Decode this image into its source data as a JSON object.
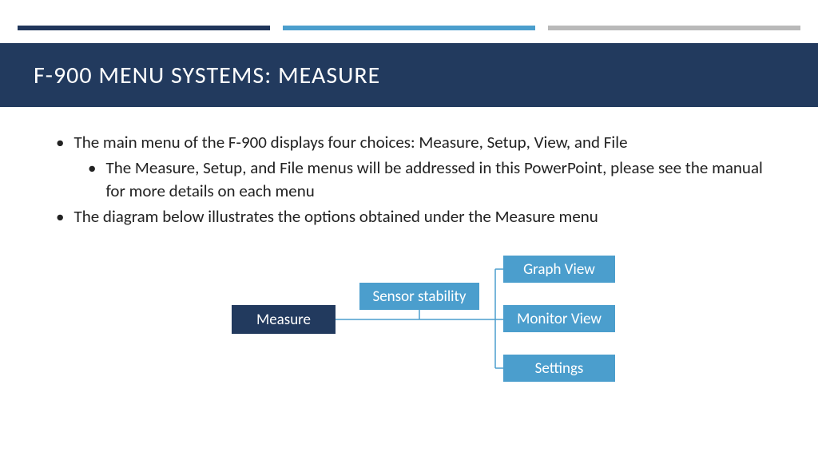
{
  "colors": {
    "dark": "#223a5e",
    "light": "#4b9ecd",
    "gray": "#b9b9b9"
  },
  "title": "F-900 MENU SYSTEMS: MEASURE",
  "bullets": {
    "b1": "The main menu of the F-900 displays four choices: Measure, Setup,  View, and File",
    "b1a": "The Measure, Setup, and File menus will be addressed in this PowerPoint, please see the manual for more details on each menu",
    "b2": "The diagram below illustrates the options obtained under the Measure menu"
  },
  "diagram": {
    "root": "Measure",
    "mid": "Sensor stability",
    "leaves": {
      "graph": "Graph View",
      "monitor": "Monitor View",
      "settings": "Settings"
    }
  }
}
